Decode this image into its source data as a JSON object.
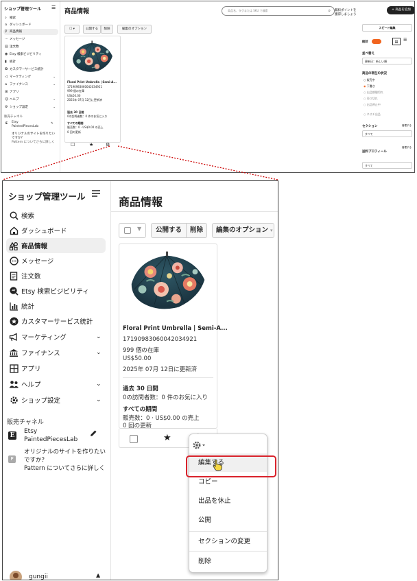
{
  "overview": {
    "sidebar": {
      "title": "ショップ管理ツール",
      "items": [
        {
          "icon": "search-icon",
          "label": "検索"
        },
        {
          "icon": "home-icon",
          "label": "ダッシュボード"
        },
        {
          "icon": "listings-icon",
          "label": "商品情報"
        },
        {
          "icon": "message-icon",
          "label": "メッセージ"
        },
        {
          "icon": "orders-icon",
          "label": "注文数"
        },
        {
          "icon": "visibility-icon",
          "label": "Etsy 検索ビジビリティ"
        },
        {
          "icon": "stats-icon",
          "label": "統計"
        },
        {
          "icon": "star-badge-icon",
          "label": "カスタマーサービス統計"
        },
        {
          "icon": "megaphone-icon",
          "label": "マーケティング"
        },
        {
          "icon": "bank-icon",
          "label": "ファイナンス"
        },
        {
          "icon": "apps-icon",
          "label": "アプリ"
        },
        {
          "icon": "help-icon",
          "label": "ヘルプ"
        },
        {
          "icon": "settings-icon",
          "label": "ショップ設定"
        }
      ],
      "channel_header": "販売チャネル",
      "etsy_line1": "Etsy",
      "etsy_line2": "PaintedPiecesLab",
      "pattern_line1": "オリジナルのサイトを作りたい",
      "pattern_line2": "ですか？",
      "pattern_line3": "Pattern についてさらに詳しく"
    },
    "header": {
      "title": "商品情報",
      "search_placeholder": "商品名、タグまたは SKU で検索",
      "promo": "無料ポイントを獲得しましょう",
      "add_button": "+ 商品を追加"
    },
    "toolbar": {
      "publish": "公開する",
      "delete": "削除",
      "edit_options": "編集のオプション"
    },
    "card": {
      "title": "Floral Print Umbrella | Semi-A...",
      "sku": "1719098306004203492​1",
      "stock": "999 個の在庫",
      "price": "US$50.00",
      "updated": "2025年 07月 12日に更新済",
      "past30_label": "過去 30 日間",
      "past30_value": "0の訪問者数：0 件のお気に入り",
      "all_label": "すべての期間",
      "all_value": "販売数：0 · US$0.00 の売上",
      "renewals": "0 回の更新"
    },
    "right": {
      "quick_edit": "スピード編集",
      "stats_label": "統計",
      "sort_label": "並べ替え",
      "sort_value": "更新日：新しい順",
      "status_label": "商品の現在の状況",
      "status_options": [
        "販売中",
        "下書き",
        "出品期間切れ",
        "売り切れ",
        "出品停止中",
        "ネオチ出品"
      ],
      "section_label": "セクション",
      "section_manage": "管理する",
      "section_value": "すべて",
      "shipping_label": "送料プロフィール",
      "shipping_manage": "管理する",
      "shipping_value": "すべて"
    }
  },
  "zoom": {
    "sidebar": {
      "title": "ショップ管理ツール",
      "items": [
        {
          "icon": "search-icon",
          "label": "検索",
          "chevron": ""
        },
        {
          "icon": "home-icon",
          "label": "ダッシュボード",
          "chevron": ""
        },
        {
          "icon": "listings-icon",
          "label": "商品情報",
          "chevron": ""
        },
        {
          "icon": "message-icon",
          "label": "メッセージ",
          "chevron": ""
        },
        {
          "icon": "orders-icon",
          "label": "注文数",
          "chevron": ""
        },
        {
          "icon": "visibility-icon",
          "label": "Etsy 検索ビジビリティ",
          "chevron": ""
        },
        {
          "icon": "stats-icon",
          "label": "統計",
          "chevron": ""
        },
        {
          "icon": "star-badge-icon",
          "label": "カスタマーサービス統計",
          "chevron": ""
        },
        {
          "icon": "megaphone-icon",
          "label": "マーケティング",
          "chevron": "⌄"
        },
        {
          "icon": "bank-icon",
          "label": "ファイナンス",
          "chevron": "⌄"
        },
        {
          "icon": "apps-icon",
          "label": "アプリ",
          "chevron": ""
        },
        {
          "icon": "help-icon",
          "label": "ヘルプ",
          "chevron": "⌄"
        },
        {
          "icon": "settings-icon",
          "label": "ショップ設定",
          "chevron": "⌄"
        }
      ],
      "channel_header": "販売チャネル",
      "etsy_badge": "E",
      "etsy_line1": "Etsy",
      "etsy_line2": "PaintedPiecesLab",
      "pattern_badge": "P",
      "pattern_line1": "オリジナルのサイトを作りたい",
      "pattern_line2": "ですか？",
      "pattern_line3": "Pattern についてさらに詳しく",
      "username": "gungii"
    },
    "title": "商品情報",
    "toolbar": {
      "publish": "公開する",
      "delete": "削除",
      "edit_options": "編集のオプション"
    },
    "card": {
      "title": "Floral Print Umbrella | Semi-A...",
      "sku": "17190983060042034921",
      "stock": "999 個の在庫",
      "price": "US$50.00",
      "updated": "2025年 07月 12日に更新済",
      "past30_label": "過去 30 日間",
      "past30_value": "0の訪問者数：0 件のお気に入り",
      "all_label": "すべての期間",
      "all_value": "販売数：0 · US$0.00 の売上",
      "renewals": "0 回の更新"
    },
    "menu": {
      "items": [
        "編集する",
        "コピー",
        "出品を休止",
        "公開",
        "セクションの変更",
        "削除"
      ]
    },
    "colors": {
      "callout": "#d9232c",
      "toggle": "#f1641e"
    }
  }
}
